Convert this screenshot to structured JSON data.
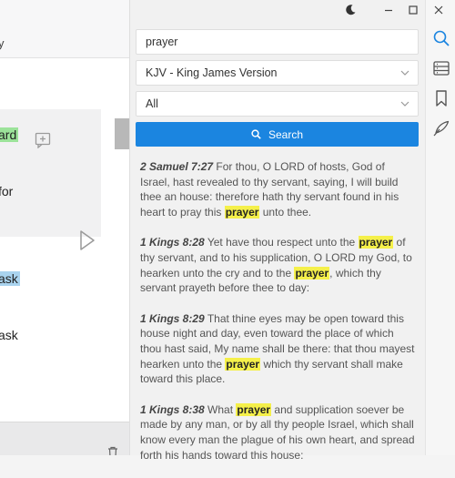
{
  "left": {
    "top_fragment": "y",
    "line1": "ard",
    "line2": "for",
    "line3": "ask",
    "line4": "ask"
  },
  "search": {
    "query": "prayer",
    "version": "KJV - King James Version",
    "scope": "All",
    "button_label": "Search"
  },
  "results": [
    {
      "ref": "2 Samuel 7:27",
      "parts": [
        "For thou, O LORD of hosts, God of Israel, hast revealed to thy servant, saying, I will build thee an house: therefore hath thy servant found in his heart to pray this ",
        "prayer",
        " unto thee."
      ]
    },
    {
      "ref": "1 Kings 8:28",
      "parts": [
        "Yet have thou respect unto the ",
        "prayer",
        " of thy servant, and to his supplication, O LORD my God, to hearken unto the cry and to the ",
        "prayer",
        ", which thy servant prayeth before thee to day:"
      ]
    },
    {
      "ref": "1 Kings 8:29",
      "parts": [
        "That thine eyes may be open toward this house night and day, even toward the place of which thou hast said, My name shall be there: that thou mayest hearken unto the ",
        "prayer",
        " which thy servant shall make toward this place."
      ]
    },
    {
      "ref": "1 Kings 8:38",
      "parts": [
        "What ",
        "prayer",
        " and supplication soever be made by any man, or by all thy people Israel, which shall know every man the plague of his own heart, and spread forth his hands toward this house:"
      ]
    }
  ],
  "colors": {
    "accent": "#1b85e0",
    "highlight": "#f5f04a",
    "green_highlight": "#9ce39a",
    "blue_highlight": "#a9d3ee"
  },
  "icons": {
    "rail": [
      "search-icon",
      "book-list-icon",
      "bookmark-icon",
      "quill-icon"
    ],
    "window": [
      "moon-icon",
      "minimize-icon",
      "maximize-icon",
      "close-icon"
    ]
  }
}
